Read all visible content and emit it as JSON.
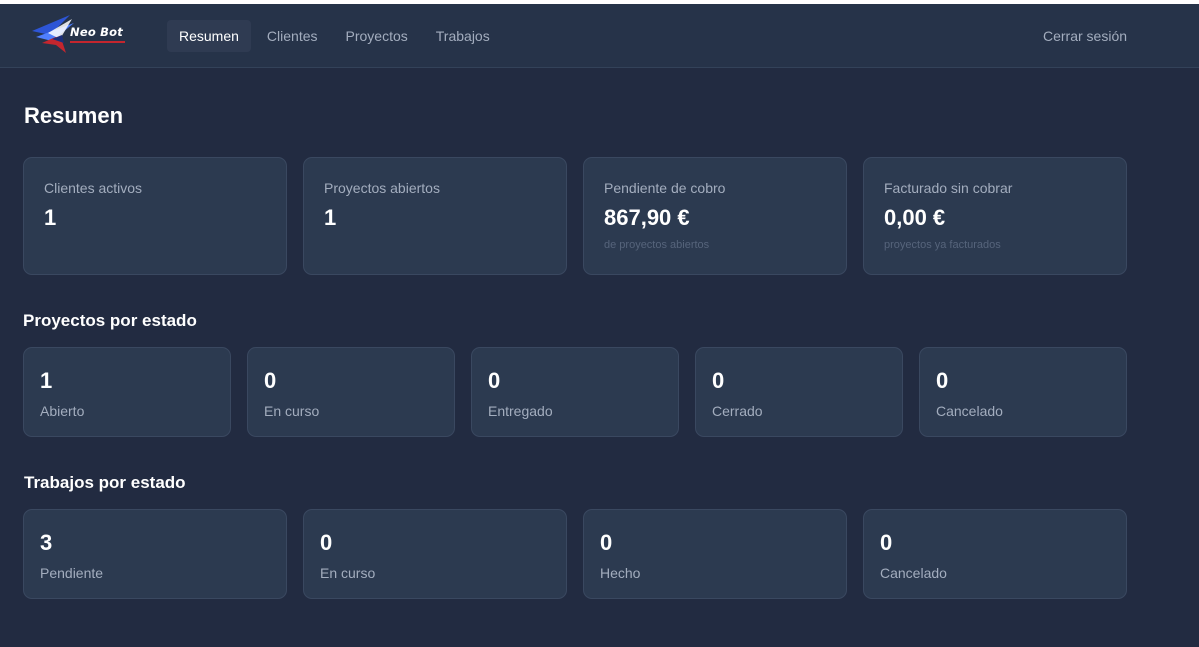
{
  "brand": {
    "name": "Neo Bot"
  },
  "nav": {
    "items": [
      {
        "label": "Resumen",
        "active": true
      },
      {
        "label": "Clientes",
        "active": false
      },
      {
        "label": "Proyectos",
        "active": false
      },
      {
        "label": "Trabajos",
        "active": false
      }
    ],
    "logout_label": "Cerrar sesión"
  },
  "page": {
    "title": "Resumen"
  },
  "kpis": [
    {
      "label": "Clientes activos",
      "value": "1",
      "sub": ""
    },
    {
      "label": "Proyectos abiertos",
      "value": "1",
      "sub": ""
    },
    {
      "label": "Pendiente de cobro",
      "value": "867,90 €",
      "sub": "de proyectos abiertos"
    },
    {
      "label": "Facturado sin cobrar",
      "value": "0,00 €",
      "sub": "proyectos ya facturados"
    }
  ],
  "projects_by_status": {
    "title": "Proyectos por estado",
    "items": [
      {
        "count": "1",
        "label": "Abierto"
      },
      {
        "count": "0",
        "label": "En curso"
      },
      {
        "count": "0",
        "label": "Entregado"
      },
      {
        "count": "0",
        "label": "Cerrado"
      },
      {
        "count": "0",
        "label": "Cancelado"
      }
    ]
  },
  "jobs_by_status": {
    "title": "Trabajos por estado",
    "items": [
      {
        "count": "3",
        "label": "Pendiente"
      },
      {
        "count": "0",
        "label": "En curso"
      },
      {
        "count": "0",
        "label": "Hecho"
      },
      {
        "count": "0",
        "label": "Cancelado"
      }
    ]
  },
  "colors": {
    "background": "#222b41",
    "navbar": "#263349",
    "card": "#2c3a50",
    "logo_blue": "#2d55d6",
    "logo_red": "#c4262e"
  }
}
